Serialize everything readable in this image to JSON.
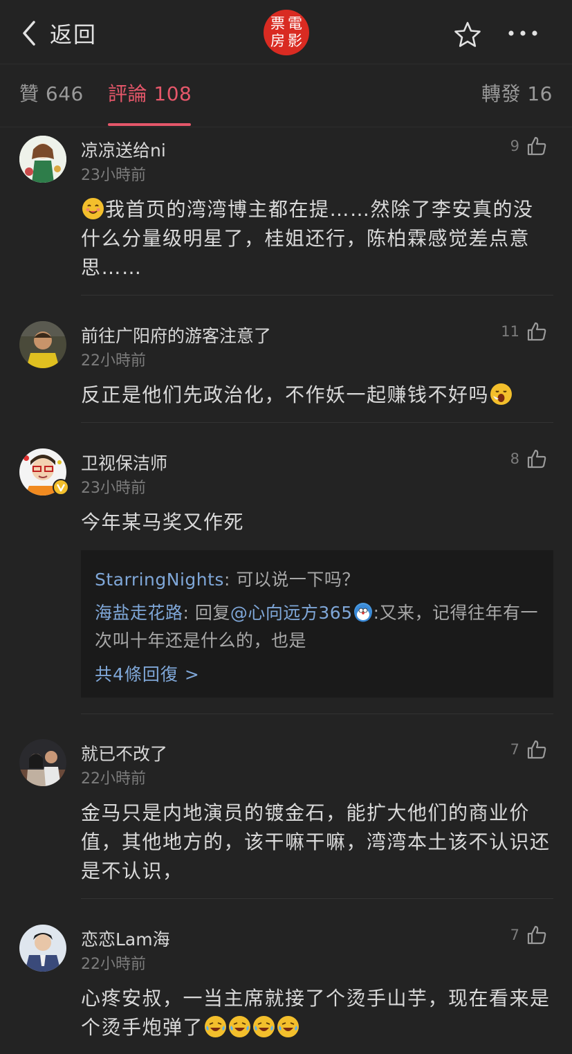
{
  "header": {
    "back_label": "返回",
    "logo_chars": [
      "票",
      "電",
      "房",
      "影"
    ]
  },
  "tabs": [
    {
      "label": "贊 646"
    },
    {
      "label": "評論 108",
      "active": true
    },
    {
      "label": "轉發 16"
    }
  ],
  "colors": {
    "accent": "#e5576a",
    "link": "#7fa7d8",
    "logo_red": "#d92b22",
    "background": "#232323"
  },
  "comments": [
    {
      "username": "凉凉送给ni",
      "time": "23小時前",
      "likes": "9",
      "content": "我首页的湾湾博主都在提……然除了李安真的没什么分量级明星了，桂姐还行，陈柏霖感觉差点意思……"
    },
    {
      "username": "前往广阳府的游客注意了",
      "time": "22小時前",
      "likes": "11",
      "content": "反正是他们先政治化，不作妖一起赚钱不好吗"
    },
    {
      "username": "卫视保洁师",
      "time": "23小時前",
      "likes": "8",
      "content": "今年某马奖又作死",
      "replies": [
        {
          "name": "StarringNights",
          "text": ": 可以说一下吗？"
        },
        {
          "name": "海盐走花路",
          "text_pre": ": 回复",
          "mention": "@心向远方365",
          "text_post": ":又来，记得往年有一次叫十年还是什么的，也是"
        }
      ],
      "all_replies_label": "共4條回復 >"
    },
    {
      "username": "就已不改了",
      "time": "22小時前",
      "likes": "7",
      "content": "金马只是内地演员的镀金石，能扩大他们的商业价值，其他地方的，该干嘛干嘛，湾湾本土该不认识还是不认识，"
    },
    {
      "username": "恋恋Lam海",
      "time": "22小時前",
      "likes": "7",
      "content": "心疼安叔，一当主席就接了个烫手山芋，现在看来是个烫手炮弹了"
    }
  ]
}
